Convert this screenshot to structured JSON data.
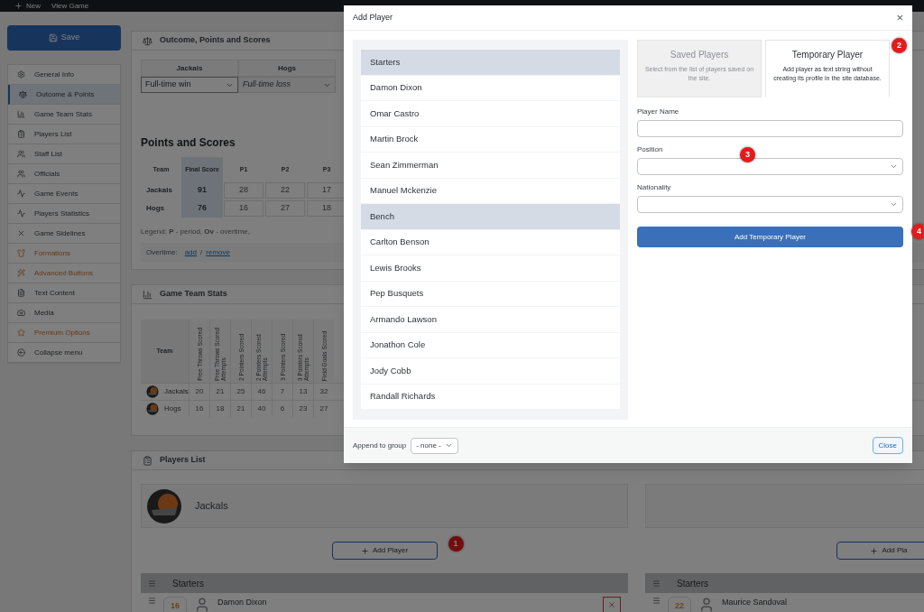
{
  "top_bar": {
    "items": [
      {
        "label": "New",
        "kind": "add"
      },
      {
        "label": "View Game",
        "kind": "link"
      }
    ]
  },
  "sidebar": {
    "save_button": "Save",
    "items": [
      {
        "label": "General Info",
        "selected": false,
        "premium": false
      },
      {
        "label": "Outcome & Points",
        "selected": true,
        "premium": false
      },
      {
        "label": "Game Team Stats",
        "selected": false,
        "premium": false
      },
      {
        "label": "Players List",
        "selected": false,
        "premium": false
      },
      {
        "label": "Staff List",
        "selected": false,
        "premium": false
      },
      {
        "label": "Officials",
        "selected": false,
        "premium": false
      },
      {
        "label": "Game Events",
        "selected": false,
        "premium": false
      },
      {
        "label": "Players Statistics",
        "selected": false,
        "premium": false
      },
      {
        "label": "Game Sidelines",
        "selected": false,
        "premium": false
      },
      {
        "label": "Formations",
        "selected": false,
        "premium": true
      },
      {
        "label": "Advanced Buttons",
        "selected": false,
        "premium": true
      },
      {
        "label": "Text Content",
        "selected": false,
        "premium": false
      },
      {
        "label": "Media",
        "selected": false,
        "premium": false
      },
      {
        "label": "Premium Options",
        "selected": false,
        "premium": true
      },
      {
        "label": "Collapse menu",
        "selected": false,
        "premium": false
      }
    ]
  },
  "outcome_panel": {
    "title": "Outcome, Points and Scores",
    "outcomes": [
      {
        "team": "Jackals",
        "value": "Full-time win",
        "disabled": false
      },
      {
        "team": "Hogs",
        "value": "Full-time loss",
        "disabled": true
      }
    ],
    "points_heading": "Points and Scores",
    "score_table": {
      "columns": [
        "Team",
        "Final Score",
        "P1",
        "P2",
        "P3"
      ],
      "rows": [
        [
          "Jackals",
          "91",
          "28",
          "22",
          "17"
        ],
        [
          "Hogs",
          "76",
          "16",
          "27",
          "18"
        ]
      ]
    },
    "legend": "Legend: **P** - period, **Ov** - overtime,",
    "overtime_label": "Overtime:",
    "overtime_links": [
      "add",
      "remove"
    ],
    "overtime_separator": "/"
  },
  "stats_panel": {
    "title": "Game Team Stats",
    "team_column": "Team",
    "columns": [
      "Free Throws Scored",
      "Free Throws Scored Attempts",
      "2 Pointers Scored",
      "2 Pointers Scored Attempts",
      "3 Pointers Scored",
      "3 Pointers Scored Attempts",
      "Field Goals Scored"
    ],
    "rows": [
      {
        "team": "Jackals",
        "values": [
          "20",
          "21",
          "25",
          "46",
          "7",
          "13",
          "32"
        ]
      },
      {
        "team": "Hogs",
        "values": [
          "16",
          "18",
          "21",
          "40",
          "6",
          "23",
          "27"
        ]
      }
    ]
  },
  "players_panel": {
    "title": "Players List",
    "teams": [
      {
        "name": "Jackals",
        "add_button": "Add Player",
        "badge": "1",
        "group": "Starters",
        "players": [
          {
            "number": "16",
            "name": "Damon Dixon",
            "removable": true
          }
        ]
      },
      {
        "add_button": "Add Pla",
        "group": "Starters",
        "players": [
          {
            "number": "22",
            "name": "Maurice Sandoval"
          }
        ]
      }
    ]
  },
  "modal": {
    "title": "Add Player",
    "close": "×",
    "list": [
      {
        "label": "Starters",
        "kind": "group"
      },
      {
        "label": "Damon Dixon",
        "kind": "player"
      },
      {
        "label": "Omar Castro",
        "kind": "player"
      },
      {
        "label": "Martin Brock",
        "kind": "player"
      },
      {
        "label": "Sean Zimmerman",
        "kind": "player"
      },
      {
        "label": "Manuel Mckenzie",
        "kind": "player"
      },
      {
        "label": "Bench",
        "kind": "group"
      },
      {
        "label": "Carlton Benson",
        "kind": "player"
      },
      {
        "label": "Lewis Brooks",
        "kind": "player"
      },
      {
        "label": "Pep Busquets",
        "kind": "player"
      },
      {
        "label": "Armando Lawson",
        "kind": "player"
      },
      {
        "label": "Jonathon Cole",
        "kind": "player"
      },
      {
        "label": "Jody Cobb",
        "kind": "player"
      },
      {
        "label": "Randall Richards",
        "kind": "player"
      }
    ],
    "tabs": [
      {
        "label": "Saved Players",
        "description": "Select from the list of players saved on the site.",
        "selected": false
      },
      {
        "label": "Temporary Player",
        "description": "Add player as text string without creating its profile in the site database.",
        "selected": true,
        "badge": "2"
      }
    ],
    "fields": [
      {
        "label": "Player Name",
        "kind": "text"
      },
      {
        "label": "Position",
        "kind": "select",
        "badge": "3"
      },
      {
        "label": "Nationality",
        "kind": "select"
      }
    ],
    "submit": {
      "label": "Add Temporary Player",
      "badge": "4"
    },
    "footer": {
      "group_label": "Append to group",
      "group_value": "- none -",
      "close_button": "Close"
    }
  }
}
